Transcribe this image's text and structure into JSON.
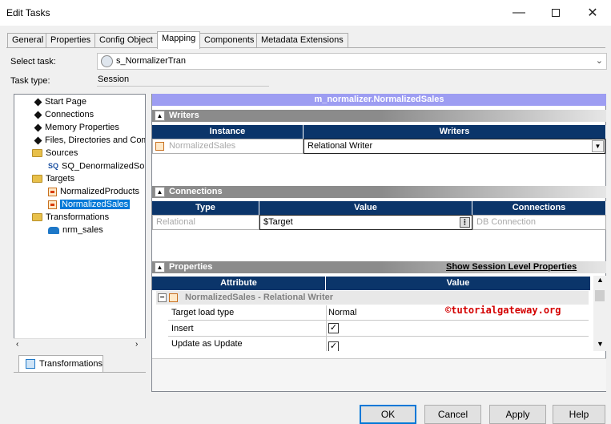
{
  "window": {
    "title": "Edit Tasks"
  },
  "tabs": [
    {
      "label": "General"
    },
    {
      "label": "Properties"
    },
    {
      "label": "Config Object"
    },
    {
      "label": "Mapping",
      "active": true
    },
    {
      "label": "Components"
    },
    {
      "label": "Metadata Extensions"
    }
  ],
  "header": {
    "select_task_label": "Select task:",
    "select_task_value": "s_NormalizerTran",
    "task_type_label": "Task type:",
    "task_type_value": "Session"
  },
  "tree": {
    "start_page": "Start Page",
    "connections": "Connections",
    "memory_properties": "Memory Properties",
    "files": "Files, Directories and Commands",
    "sources": "Sources",
    "source_1": "SQ_DenormalizedSource",
    "targets": "Targets",
    "target_1": "NormalizedProducts",
    "target_2": "NormalizedSales",
    "transformations": "Transformations",
    "transformation_1": "nrm_sales"
  },
  "left_tab": {
    "label": "Transformations"
  },
  "mapping": {
    "header": "m_normalizer.NormalizedSales"
  },
  "writers": {
    "title": "Writers",
    "col_instance": "Instance",
    "col_writers": "Writers",
    "instance": "NormalizedSales",
    "writer": "Relational Writer"
  },
  "connections": {
    "title": "Connections",
    "col_type": "Type",
    "col_value": "Value",
    "col_connections": "Connections",
    "type": "Relational",
    "value": "$Target",
    "connection": "DB Connection"
  },
  "properties": {
    "title": "Properties",
    "show_session_link": "Show Session Level Properties",
    "col_attribute": "Attribute",
    "col_value": "Value",
    "group": "NormalizedSales - Relational Writer",
    "rows": [
      {
        "attribute": "Target load type",
        "value": "Normal"
      },
      {
        "attribute": "Insert",
        "checked": true
      },
      {
        "attribute": "Update as Update",
        "checked": true
      }
    ]
  },
  "watermark": "©tutorialgateway.org",
  "buttons": {
    "ok": "OK",
    "cancel": "Cancel",
    "apply": "Apply",
    "help": "Help"
  }
}
